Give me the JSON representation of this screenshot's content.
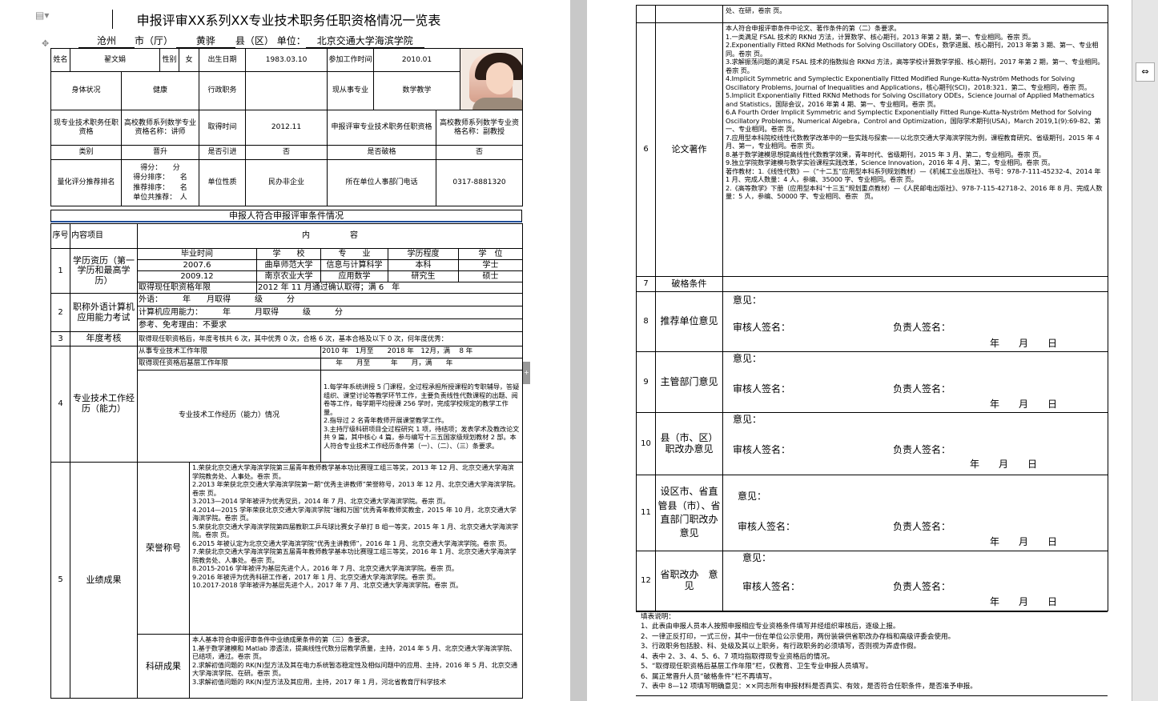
{
  "page1": {
    "title": "申报评审XX系列XX专业技术职务任职资格情况一览表",
    "location": {
      "city": "沧州",
      "city_unit": "市（厅）",
      "county": "黄骅",
      "county_unit": "县（区）",
      "unit_label": "单位：",
      "unit": "北京交通大学海滨学院"
    },
    "basic": {
      "name_label": "姓名",
      "name": "翟文娟",
      "gender_label": "性别",
      "gender": "女",
      "birth_label": "出生日期",
      "birth": "1983.03.10",
      "work_label": "参加工作时间",
      "work": "2010.01",
      "health_label": "身体状况",
      "health": "健康",
      "admin_label": "行政职务",
      "admin": "",
      "major_label": "现从事专业",
      "major": "数学教学",
      "cur_label": "现专业技术职务任职资格",
      "cur": "高校教师系列数学专业资格名称：讲师",
      "get_label": "取得时间",
      "get": "2012.11",
      "apply_label": "申报评审专业技术职务任职资格",
      "apply": "高校教师系列数学专业资格名称：副教授",
      "type_label": "类别",
      "type": "晋升",
      "intro_label": "是否引进",
      "intro": "否",
      "break_label": "是否破格",
      "break": "否",
      "rank_label": "量化评分推荐排名",
      "rank_lines": [
        "得分：　　分",
        "得分排序：　　名",
        "推荐排序：　　名",
        "单位共推荐：　人"
      ],
      "nature_label": "单位性质",
      "nature": "民办非企业",
      "phone_label": "所在单位人事部门电话",
      "phone": "0317-8881320"
    },
    "section_title": "申报人符合申报评审条件情况",
    "hdr": {
      "no": "序号",
      "item": "内容项目",
      "content": "内　　　　　容"
    },
    "r1": {
      "no": "1",
      "label": "学历资历（第一学历和最高学历）",
      "cols": [
        "毕业时间",
        "学　　校",
        "专　　业",
        "学历程度",
        "学　位"
      ],
      "rows": [
        [
          "2007.6",
          "曲阜师范大学",
          "信息与计算科学",
          "本科",
          "学士"
        ],
        [
          "2009.12",
          "南京农业大学",
          "应用数学",
          "研究生",
          "硕士"
        ]
      ],
      "qual_label": "取得现任职资格年限",
      "qual": "2012 年 11 月通过确认取得；满 6　年"
    },
    "r2": {
      "no": "2",
      "label": "职称外语计算机应用能力考试",
      "lines": [
        "外语：　　　年　　月取得　　　级　　　分",
        "计算机应用能力：　　　年　　　月取得　　　级　　　分",
        "参考、免考理由：不要求"
      ]
    },
    "r3": {
      "no": "3",
      "label": "年度考核",
      "text": "取得现任职资格后，年度考核共 6 次，其中优秀 0 次，合格 6 次，基本合格及以下 0 次，何年度优秀："
    },
    "r4": {
      "no": "4",
      "label": "专业技术工作经历（能力）",
      "y1_label": "从事专业技术工作年限",
      "y1": "2010 年　1月至　　2018 年　12月，满　 8 年",
      "y2_label": "取得现任资格后基层工作年限",
      "y2": "　　年　　月至　　　年　　月，满　　年",
      "sub": "专业技术工作经历（能力）情况",
      "text": "1.每学年系统讲授 5 门课程，全过程承担所授课程的专职辅导，答疑组织、课堂讨论等教学环节工作，主要负责线性代数课程的出题、阅卷等工作，每学期平均授课 256 学时，完成学校规定的教学工作量。\n2.指导过 2 名青年教师开展课堂教学工作。\n3.主持厅级科研项目全过程研究 1 项，待结项；发表学术及教改论文共 9 篇，其中核心 4 篇，参与编写十三五国家级规划教材 2 部。本人符合专业技术工作经历条件第（一）、（二）、（三）条要求。"
    },
    "r5": {
      "no": "5",
      "label": "业绩成果",
      "honor_label": "荣誉称号",
      "honor": "1.荣获北京交通大学海滨学院第三届青年教师教学基本功比赛理工组三等奖，2013 年 12 月、北京交通大学海滨学院教务处、人事处。卷宗 页。\n2.2013 年荣获北京交通大学海滨学院第一期“优秀主讲教师”荣誉称号，2013 年 12 月、北京交通大学海滨学院。卷宗 页。\n3.2013—2014 学年被评为优秀党员，2014 年 7 月、北京交通大学海滨学院。卷宗 页。\n4.2014—2015 学年荣获北京交通大学海滨学院“瑞和万国”优秀青年教师奖教金，2015 年 10 月，北京交通大学海滨学院。卷宗 页。\n5.荣获北京交通大学海滨学院第四届教职工乒乓球比赛女子单打 B 组一等奖，2015 年 1 月、北京交通大学海滨学院。卷宗 页。\n6.2015 年被认定为北京交通大学海滨学院“优秀主讲教师”，2016 年 1 月、北京交通大学海滨学院。卷宗 页。\n7.荣获北京交通大学海滨学院第五届青年教师教学基本功比赛理工组三等奖，2016 年 1 月、北京交通大学海滨学院教务处、人事处。卷宗 页。\n8.2015-2016 学年被评为基层先进个人，2016 年 7 月、北京交通大学海滨学院。卷宗 页。\n9.2016 年被评为优秀科研工作者，2017 年 1 月、北京交通大学海滨学院。卷宗 页。\n10.2017-2018 学年被评为基层先进个人，2017 年 7 月、北京交通大学海滨学院。卷宗 页。",
      "res_label": "科研成果",
      "res": "本人基本符合申报评审条件中业绩成果条件的第（三）条要求。\n1.基于数学建模和 Matlab 渗透法，提高线性代数分层教学质量，主持，2014 年 5 月、北京交通大学海滨学院、已结项，通过。卷宗 页。\n2.求解初值问题的 RK(N)型方法及其在电力系统暂态稳定性及相似问题中的应用、主持，2016 年 5 月、北京交通大学海滨学院、在研。卷宗 页。\n3.求解初值问题的 RK(N)型方法及其应用，主持，2017 年 1 月，河北省教育厅科学技术"
    }
  },
  "page2": {
    "top_cont": "处、在研，卷宗 页。",
    "r6": {
      "no": "6",
      "label": "论文著作",
      "text": "本人符合申报评审条件中论文、著作条件的第（二）条要求。\n1.一类满足 FSAL 技术的 RKNd 方法，计算数学、核心期刊，2013 年第 2 期，第一、专业相同。卷宗 页。\n2.Exponentially Fitted RKNd Methods for Solving Oscillatory ODEs，数学进展、核心期刊，2013 年第 3 期、第一、专业相同。卷宗 页。\n3.求解振荡问题的满足 FSAL 技术的指数拟合 RKNd 方法，高等学校计算数学学报、核心期刊，2017 年第 2 期，第一、专业相同。卷宗 页。\n4.Implicit Symmetric and Symplectic Exponentially Fitted Modified Runge-Kutta-Nyström Methods for Solving Oscillatory Problems, Journal of Inequalities and Applications，核心期刊(SCI)，2018:321．第二、专业相同，卷宗 页。\n5.Implicit Exponentially Fitted RKNd Methods for Solving Oscillatory ODEs，Science Journal of Applied Mathematics and Statistics，国际会议，2016 年第 4 期、第一、专业相同。卷宗 页。\n6.A Fourth Order Implicit Symmetric and Symplectic Exponentially Fitted Runge-Kutta-Nyström Method for Solving Oscillatory Problems，Numerical Algebra，Control and Optimization，国际学术期刊(USA)，March 2019,1(9):69-82、第一、专业相同。卷宗 页。\n7.应用型本科院校线性代数教学改革中的一些实践与探索——以北京交通大学海滨学院为例，课程教育研究、省级期刊，2015 年 4 月、第一，专业相同。卷宗 页。\n8.基于数学建模思想提高线性代数教学效果，青年时代、省级期刊，2015 年 3 月、第二，专业相同。卷宗 页。\n9.独立学院数学建模与数学实验课程实践改革，Science Innovation，2016 年 4 月、第二，专业相同。卷宗 页。\n著作教材：1.《线性代数》—（“十二五”应用型本科系列规划教材）—《机械工业出版社》、书号：978-7-111-45232-4、2014 年 1 月、完成人数量：4 人，参编、35000 字、专业相同。卷宗 页。\n2.《高等数学》下册（应用型本科“十三五”规划重点教材）—《人民邮电出版社》、978-7-115-42718-2、2016 年 8 月、完成人数量：5 人，参编、50000 字、专业相同、卷宗　页。"
    },
    "r7": {
      "no": "7",
      "label": "破格条件",
      "text": ""
    },
    "opinions": [
      {
        "no": "8",
        "label": "推荐单位意见",
        "yj": "意见：",
        "rev": "审核人签名：",
        "resp": "负责人签名：",
        "date": "年　　月　　日"
      },
      {
        "no": "9",
        "label": "主管部门意见",
        "yj": "意见：",
        "rev": "审核人签名：",
        "resp": "负责人签名：",
        "date": "年　　月　　日"
      },
      {
        "no": "10",
        "label": "县（市、区）职改办意见",
        "yj": "意见：",
        "rev": "审核人签名：",
        "resp": "负责人签名：",
        "date": "年　　月　　日"
      },
      {
        "no": "11",
        "label": "设区市、省直管县（市）、省直部门职改办意见",
        "yj": "意见：",
        "rev": "审核人签名：",
        "resp": "负责人签名：",
        "date": "年　　月　　日"
      },
      {
        "no": "12",
        "label": "省职改办　意　见",
        "yj": "意见：",
        "rev": "审核人签名：",
        "resp": "负责人签名：",
        "date": "年　　月　　日"
      }
    ],
    "notes_title": "填表说明：",
    "notes": [
      "1、此表由申报人员本人按照申报相应专业资格条件填写并经组织审核后，逐级上报。",
      "2、一律正反打印，一式三份，其中一份在单位公示使用，两份装袋供省职改办存档和高级评委会使用。",
      "3、行政职务包括股、科、处级及其以上职务，有行政职务的必须填写，否则视为弄虚作假。",
      "4、表中 2、3、4、5、6、7 项均指取得现专业资格后的情况。",
      "5、“取得现任职资格后基层工作年限”栏，仅教育、卫生专业申报人员填写。",
      "6、属正常晋升人员“破格条件”栏不再填写。",
      "7、表中 8—12 项填写明确意见：××同志所有申报材料是否真实、有效，是否符合任职条件，是否准予申报。"
    ]
  }
}
